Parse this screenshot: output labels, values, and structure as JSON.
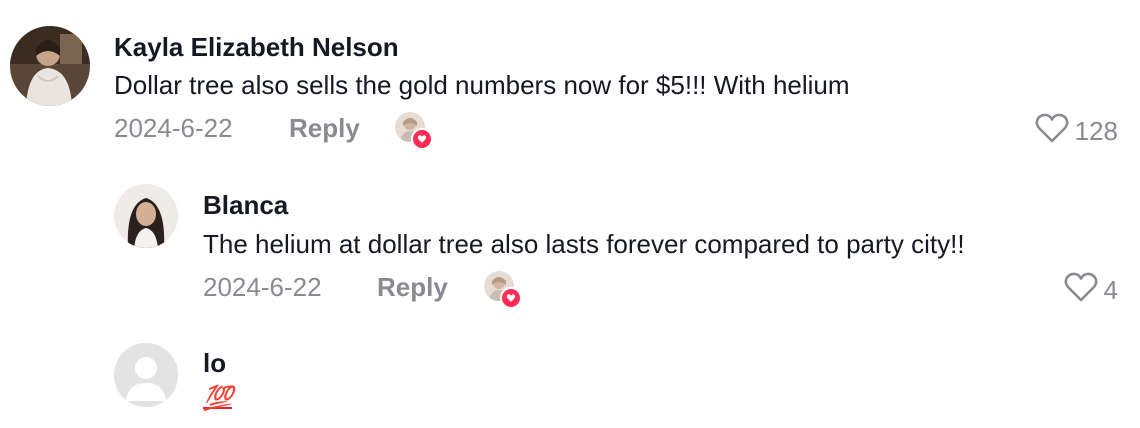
{
  "comments": [
    {
      "username": "Kayla Elizabeth Nelson",
      "text": "Dollar tree also sells the gold numbers now for $5!!! With helium",
      "date": "2024-6-22",
      "reply_label": "Reply",
      "likes": "128"
    },
    {
      "username": "Blanca",
      "text": "The helium at dollar tree also lasts forever compared to party city!!",
      "date": "2024-6-22",
      "reply_label": "Reply",
      "likes": "4"
    },
    {
      "username": "lo",
      "text": "💯"
    }
  ],
  "colors": {
    "primary_text": "#161823",
    "secondary_text": "#8a8b91",
    "like_badge": "#fe2c55"
  },
  "icons": {
    "like": "heart-outline-icon",
    "creator_liked": "creator-liked-heart-icon",
    "default_avatar": "default-avatar-icon"
  }
}
